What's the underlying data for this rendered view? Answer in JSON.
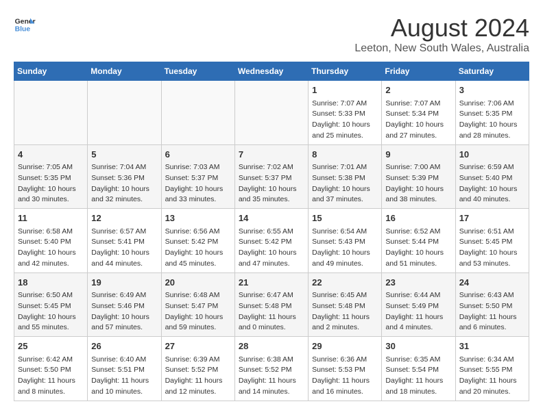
{
  "header": {
    "logo_line1": "General",
    "logo_line2": "Blue",
    "month_year": "August 2024",
    "location": "Leeton, New South Wales, Australia"
  },
  "weekdays": [
    "Sunday",
    "Monday",
    "Tuesday",
    "Wednesday",
    "Thursday",
    "Friday",
    "Saturday"
  ],
  "weeks": [
    [
      {
        "day": "",
        "content": ""
      },
      {
        "day": "",
        "content": ""
      },
      {
        "day": "",
        "content": ""
      },
      {
        "day": "",
        "content": ""
      },
      {
        "day": "1",
        "content": "Sunrise: 7:07 AM\nSunset: 5:33 PM\nDaylight: 10 hours\nand 25 minutes."
      },
      {
        "day": "2",
        "content": "Sunrise: 7:07 AM\nSunset: 5:34 PM\nDaylight: 10 hours\nand 27 minutes."
      },
      {
        "day": "3",
        "content": "Sunrise: 7:06 AM\nSunset: 5:35 PM\nDaylight: 10 hours\nand 28 minutes."
      }
    ],
    [
      {
        "day": "4",
        "content": "Sunrise: 7:05 AM\nSunset: 5:35 PM\nDaylight: 10 hours\nand 30 minutes."
      },
      {
        "day": "5",
        "content": "Sunrise: 7:04 AM\nSunset: 5:36 PM\nDaylight: 10 hours\nand 32 minutes."
      },
      {
        "day": "6",
        "content": "Sunrise: 7:03 AM\nSunset: 5:37 PM\nDaylight: 10 hours\nand 33 minutes."
      },
      {
        "day": "7",
        "content": "Sunrise: 7:02 AM\nSunset: 5:37 PM\nDaylight: 10 hours\nand 35 minutes."
      },
      {
        "day": "8",
        "content": "Sunrise: 7:01 AM\nSunset: 5:38 PM\nDaylight: 10 hours\nand 37 minutes."
      },
      {
        "day": "9",
        "content": "Sunrise: 7:00 AM\nSunset: 5:39 PM\nDaylight: 10 hours\nand 38 minutes."
      },
      {
        "day": "10",
        "content": "Sunrise: 6:59 AM\nSunset: 5:40 PM\nDaylight: 10 hours\nand 40 minutes."
      }
    ],
    [
      {
        "day": "11",
        "content": "Sunrise: 6:58 AM\nSunset: 5:40 PM\nDaylight: 10 hours\nand 42 minutes."
      },
      {
        "day": "12",
        "content": "Sunrise: 6:57 AM\nSunset: 5:41 PM\nDaylight: 10 hours\nand 44 minutes."
      },
      {
        "day": "13",
        "content": "Sunrise: 6:56 AM\nSunset: 5:42 PM\nDaylight: 10 hours\nand 45 minutes."
      },
      {
        "day": "14",
        "content": "Sunrise: 6:55 AM\nSunset: 5:42 PM\nDaylight: 10 hours\nand 47 minutes."
      },
      {
        "day": "15",
        "content": "Sunrise: 6:54 AM\nSunset: 5:43 PM\nDaylight: 10 hours\nand 49 minutes."
      },
      {
        "day": "16",
        "content": "Sunrise: 6:52 AM\nSunset: 5:44 PM\nDaylight: 10 hours\nand 51 minutes."
      },
      {
        "day": "17",
        "content": "Sunrise: 6:51 AM\nSunset: 5:45 PM\nDaylight: 10 hours\nand 53 minutes."
      }
    ],
    [
      {
        "day": "18",
        "content": "Sunrise: 6:50 AM\nSunset: 5:45 PM\nDaylight: 10 hours\nand 55 minutes."
      },
      {
        "day": "19",
        "content": "Sunrise: 6:49 AM\nSunset: 5:46 PM\nDaylight: 10 hours\nand 57 minutes."
      },
      {
        "day": "20",
        "content": "Sunrise: 6:48 AM\nSunset: 5:47 PM\nDaylight: 10 hours\nand 59 minutes."
      },
      {
        "day": "21",
        "content": "Sunrise: 6:47 AM\nSunset: 5:48 PM\nDaylight: 11 hours\nand 0 minutes."
      },
      {
        "day": "22",
        "content": "Sunrise: 6:45 AM\nSunset: 5:48 PM\nDaylight: 11 hours\nand 2 minutes."
      },
      {
        "day": "23",
        "content": "Sunrise: 6:44 AM\nSunset: 5:49 PM\nDaylight: 11 hours\nand 4 minutes."
      },
      {
        "day": "24",
        "content": "Sunrise: 6:43 AM\nSunset: 5:50 PM\nDaylight: 11 hours\nand 6 minutes."
      }
    ],
    [
      {
        "day": "25",
        "content": "Sunrise: 6:42 AM\nSunset: 5:50 PM\nDaylight: 11 hours\nand 8 minutes."
      },
      {
        "day": "26",
        "content": "Sunrise: 6:40 AM\nSunset: 5:51 PM\nDaylight: 11 hours\nand 10 minutes."
      },
      {
        "day": "27",
        "content": "Sunrise: 6:39 AM\nSunset: 5:52 PM\nDaylight: 11 hours\nand 12 minutes."
      },
      {
        "day": "28",
        "content": "Sunrise: 6:38 AM\nSunset: 5:52 PM\nDaylight: 11 hours\nand 14 minutes."
      },
      {
        "day": "29",
        "content": "Sunrise: 6:36 AM\nSunset: 5:53 PM\nDaylight: 11 hours\nand 16 minutes."
      },
      {
        "day": "30",
        "content": "Sunrise: 6:35 AM\nSunset: 5:54 PM\nDaylight: 11 hours\nand 18 minutes."
      },
      {
        "day": "31",
        "content": "Sunrise: 6:34 AM\nSunset: 5:55 PM\nDaylight: 11 hours\nand 20 minutes."
      }
    ]
  ]
}
